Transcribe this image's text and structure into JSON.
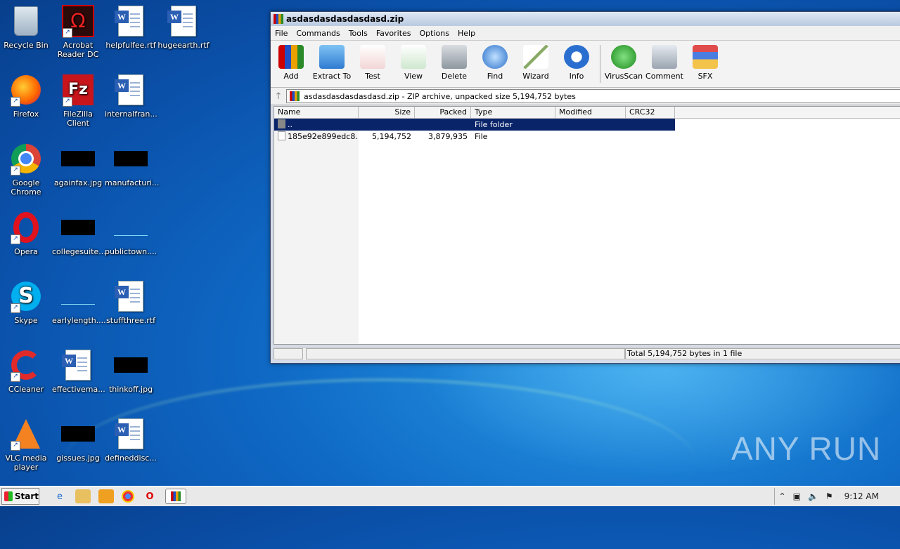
{
  "desktop": {
    "icons": [
      {
        "label": "Recycle Bin",
        "icon": "recycle-bin-icon"
      },
      {
        "label": "Acrobat Reader DC",
        "icon": "acrobat-icon"
      },
      {
        "label": "helpfulfee.rtf",
        "icon": "word-doc-icon"
      },
      {
        "label": "hugeearth.rtf",
        "icon": "word-doc-icon"
      },
      {
        "label": "Firefox",
        "icon": "firefox-icon"
      },
      {
        "label": "FileZilla Client",
        "icon": "filezilla-icon"
      },
      {
        "label": "internalfran...",
        "icon": "word-doc-icon"
      },
      {
        "label": "Google Chrome",
        "icon": "chrome-icon"
      },
      {
        "label": "againfax.jpg",
        "icon": "jpg-thumb-icon"
      },
      {
        "label": "manufacturi...",
        "icon": "jpg-thumb-icon"
      },
      {
        "label": "Opera",
        "icon": "opera-icon"
      },
      {
        "label": "collegesuite....",
        "icon": "jpg-thumb-icon"
      },
      {
        "label": "publictown....",
        "icon": "jpg-thumb-icon"
      },
      {
        "label": "Skype",
        "icon": "skype-icon"
      },
      {
        "label": "earlylength....",
        "icon": "jpg-thumb-icon"
      },
      {
        "label": "stuffthree.rtf",
        "icon": "word-doc-icon"
      },
      {
        "label": "CCleaner",
        "icon": "ccleaner-icon"
      },
      {
        "label": "effectivema...",
        "icon": "word-doc-icon"
      },
      {
        "label": "thinkoff.jpg",
        "icon": "jpg-thumb-icon"
      },
      {
        "label": "VLC media player",
        "icon": "vlc-icon"
      },
      {
        "label": "gissues.jpg",
        "icon": "jpg-thumb-icon"
      },
      {
        "label": "defineddisc...",
        "icon": "word-doc-icon"
      }
    ]
  },
  "window": {
    "title": "asdasdasdasdasdasd.zip",
    "menu": [
      "File",
      "Commands",
      "Tools",
      "Favorites",
      "Options",
      "Help"
    ],
    "toolbar": [
      {
        "label": "Add",
        "icon": "add-archive-icon"
      },
      {
        "label": "Extract To",
        "icon": "extract-icon"
      },
      {
        "label": "Test",
        "icon": "test-icon"
      },
      {
        "label": "View",
        "icon": "view-icon"
      },
      {
        "label": "Delete",
        "icon": "delete-icon"
      },
      {
        "label": "Find",
        "icon": "find-icon"
      },
      {
        "label": "Wizard",
        "icon": "wizard-icon"
      },
      {
        "label": "Info",
        "icon": "info-icon"
      },
      {
        "label": "VirusScan",
        "icon": "virusscan-icon"
      },
      {
        "label": "Comment",
        "icon": "comment-icon"
      },
      {
        "label": "SFX",
        "icon": "sfx-icon"
      }
    ],
    "address": "asdasdasdasdasdasd.zip - ZIP archive, unpacked size 5,194,752 bytes",
    "columns": [
      "Name",
      "Size",
      "Packed",
      "Type",
      "Modified",
      "CRC32"
    ],
    "rows": [
      {
        "name": "..",
        "size": "",
        "packed": "",
        "type": "File folder",
        "modified": "",
        "crc": ""
      },
      {
        "name": "185e92e899edc8...",
        "size": "5,194,752",
        "packed": "3,879,935",
        "type": "File",
        "modified": "",
        "crc": ""
      }
    ],
    "status": "Total 5,194,752 bytes in 1 file"
  },
  "taskbar": {
    "start": "Start",
    "clock": "9:12 AM"
  },
  "watermark": "ANY RUN"
}
